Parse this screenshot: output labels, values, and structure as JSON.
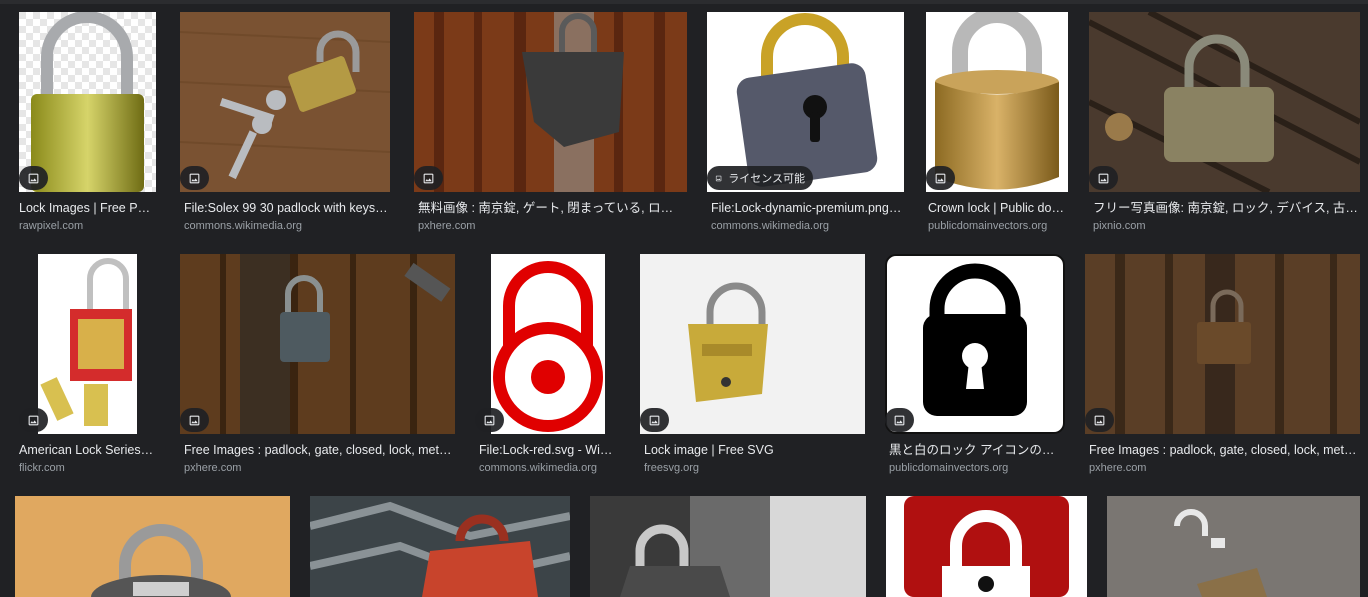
{
  "results": [
    {
      "title": "Lock Images | Free Pho…",
      "source": "rawpixel.com",
      "badge": ""
    },
    {
      "title": "File:Solex 99 30 padlock with keys (…",
      "source": "commons.wikimedia.org",
      "badge": ""
    },
    {
      "title": "無料画像 : 南京錠, ゲート, 閉まっている, ロッ…",
      "source": "pxhere.com",
      "badge": ""
    },
    {
      "title": "File:Lock-dynamic-premium.png …",
      "source": "commons.wikimedia.org",
      "badge": "ライセンス可能"
    },
    {
      "title": "Crown lock | Public do…",
      "source": "publicdomainvectors.org",
      "badge": ""
    },
    {
      "title": "フリー写真画像: 南京錠, ロック, デバイス, 古い…",
      "source": "pixnio.com",
      "badge": ""
    },
    {
      "title": "American Lock Series …",
      "source": "flickr.com",
      "badge": ""
    },
    {
      "title": "Free Images : padlock, gate, closed, lock, metal…",
      "source": "pxhere.com",
      "badge": ""
    },
    {
      "title": "File:Lock-red.svg - Wiki…",
      "source": "commons.wikimedia.org",
      "badge": ""
    },
    {
      "title": "Lock image | Free SVG",
      "source": "freesvg.org",
      "badge": ""
    },
    {
      "title": "黒と白のロック アイコンのベ…",
      "source": "publicdomainvectors.org",
      "badge": ""
    },
    {
      "title": "Free Images : padlock, gate, closed, lock, metal…",
      "source": "pxhere.com",
      "badge": ""
    },
    {
      "title": "",
      "source": "",
      "badge": ""
    },
    {
      "title": "",
      "source": "",
      "badge": ""
    },
    {
      "title": "",
      "source": "",
      "badge": ""
    },
    {
      "title": "",
      "source": "",
      "badge": ""
    },
    {
      "title": "",
      "source": "",
      "badge": ""
    }
  ],
  "icons": {
    "image_badge": "image-icon"
  },
  "colors": {
    "page_bg": "#202124",
    "title_text": "#e8eaed",
    "source_text": "#9aa0a6",
    "badge_bg": "#202124"
  }
}
